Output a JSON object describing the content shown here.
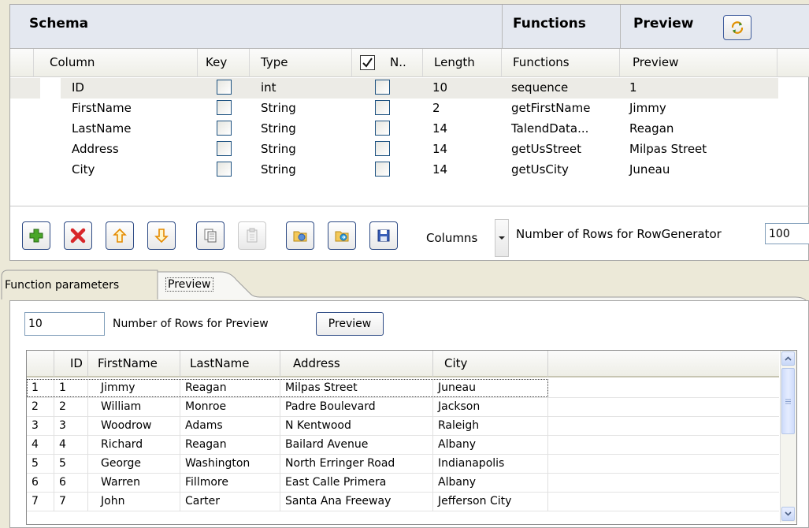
{
  "schema": {
    "title": "Schema",
    "functions_title": "Functions",
    "preview_title": "Preview",
    "columns": [
      "Column",
      "Key",
      "Type",
      "N..",
      "Length",
      "Functions",
      "Preview"
    ],
    "rows": [
      {
        "column": "ID",
        "key": false,
        "type": "int",
        "nullable": false,
        "length": "10",
        "function": "sequence",
        "preview": "1"
      },
      {
        "column": "FirstName",
        "key": false,
        "type": "String",
        "nullable": false,
        "length": "2",
        "function": "getFirstName",
        "preview": "Jimmy"
      },
      {
        "column": "LastName",
        "key": false,
        "type": "String",
        "nullable": false,
        "length": "14",
        "function": "TalendData...",
        "preview": "Reagan"
      },
      {
        "column": "Address",
        "key": false,
        "type": "String",
        "nullable": false,
        "length": "14",
        "function": "getUsStreet",
        "preview": "Milpas Street"
      },
      {
        "column": "City",
        "key": false,
        "type": "String",
        "nullable": false,
        "length": "14",
        "function": "getUsCity",
        "preview": "Juneau"
      }
    ],
    "toolbar": {
      "columns_label": "Columns",
      "rows_label": "Number of Rows for RowGenerator",
      "rows_value": "100"
    }
  },
  "tabs": [
    "Function parameters",
    "Preview"
  ],
  "preview": {
    "rows_value": "10",
    "rows_label": "Number of Rows for Preview",
    "button_label": "Preview",
    "headers": [
      "",
      "ID",
      "FirstName",
      "LastName",
      "Address",
      "City"
    ],
    "rows": [
      [
        "1",
        "1",
        "Jimmy",
        "Reagan",
        "Milpas Street",
        "Juneau"
      ],
      [
        "2",
        "2",
        "William",
        "Monroe",
        "Padre Boulevard",
        "Jackson"
      ],
      [
        "3",
        "3",
        "Woodrow",
        "Adams",
        "N Kentwood",
        "Raleigh"
      ],
      [
        "4",
        "4",
        "Richard",
        "Reagan",
        "Bailard Avenue",
        "Albany"
      ],
      [
        "5",
        "5",
        "George",
        "Washington",
        "North Erringer Road",
        "Indianapolis"
      ],
      [
        "6",
        "6",
        "Warren",
        "Fillmore",
        "East Calle Primera",
        "Albany"
      ],
      [
        "7",
        "7",
        "John",
        "Carter",
        "Santa Ana Freeway",
        "Jefferson City"
      ]
    ]
  },
  "colors": {
    "selected_row": "#ecebe6",
    "header_bg": "#e4e8f0",
    "button_border": "#2e4b85"
  }
}
